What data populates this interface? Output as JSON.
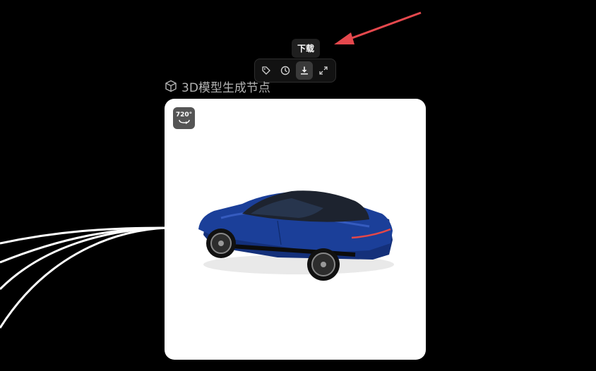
{
  "tooltip": {
    "text": "下载"
  },
  "toolbar": {
    "buttons": [
      {
        "icon": "tag-icon"
      },
      {
        "icon": "clock-icon"
      },
      {
        "icon": "download-icon",
        "active": true
      },
      {
        "icon": "expand-icon"
      }
    ]
  },
  "node": {
    "icon": "cube-icon",
    "title": "3D模型生成节点",
    "badge": "720°",
    "preview": "car-model"
  },
  "colors": {
    "background": "#000000",
    "card": "#ffffff",
    "annotation_arrow": "#e5484d",
    "car_body": "#1b3f99",
    "wire": "#ffffff"
  }
}
